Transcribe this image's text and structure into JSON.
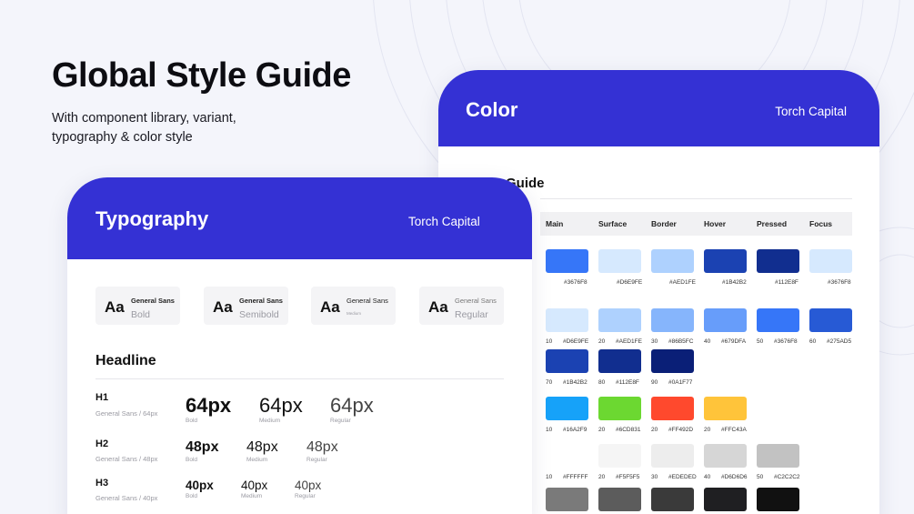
{
  "hero": {
    "title": "Global Style Guide",
    "subtitle_line1": "With component library, variant,",
    "subtitle_line2": "typography & color style"
  },
  "colors": {
    "brand_blue": "#3431D4",
    "background": "#F4F5FB"
  },
  "color_card": {
    "title": "Color",
    "brand": "Torch Capital",
    "section_title_visible": "Guide",
    "columns": [
      "Main",
      "Surface",
      "Border",
      "Hover",
      "Pressed",
      "Focus"
    ],
    "main_row": [
      {
        "hex": "#3676F8",
        "label": "#3676F8"
      },
      {
        "hex": "#D6E9FE",
        "label": "#D6E9FE"
      },
      {
        "hex": "#AED1FE",
        "label": "#AED1FE"
      },
      {
        "hex": "#1B42B2",
        "label": "#1B42B2"
      },
      {
        "hex": "#112E8F",
        "label": "#112E8F"
      },
      {
        "hex": "#D6E9FE",
        "label": "#3676F8"
      }
    ],
    "blue_scale": [
      {
        "step": "10",
        "hex": "#D6E9FE"
      },
      {
        "step": "20",
        "hex": "#AED1FE"
      },
      {
        "step": "30",
        "hex": "#86B5FC"
      },
      {
        "step": "40",
        "hex": "#679DFA"
      },
      {
        "step": "50",
        "hex": "#3676F8"
      },
      {
        "step": "60",
        "hex": "#275AD5"
      }
    ],
    "blue_dark": [
      {
        "step": "70",
        "hex": "#1B42B2"
      },
      {
        "step": "80",
        "hex": "#112E8F"
      },
      {
        "step": "90",
        "hex": "#0A1F77"
      }
    ],
    "accents": [
      {
        "step": "10",
        "hex": "#16A2F9"
      },
      {
        "step": "20",
        "hex": "#6CD831"
      },
      {
        "step": "20",
        "hex": "#FF492D"
      },
      {
        "step": "20",
        "hex": "#FFC43A"
      }
    ],
    "neutrals": [
      {
        "step": "10",
        "hex": "#FFFFFF"
      },
      {
        "step": "20",
        "hex": "#F5F5F5"
      },
      {
        "step": "30",
        "hex": "#EDEDED"
      },
      {
        "step": "40",
        "hex": "#D6D6D6"
      },
      {
        "step": "50",
        "hex": "#C2C2C2"
      }
    ],
    "darks": [
      "#7A7A7A",
      "#5C5C5C",
      "#3A3A3A",
      "#1F1F22",
      "#111111"
    ]
  },
  "typo_card": {
    "title": "Typography",
    "brand": "Torch Capital",
    "fonts": [
      {
        "aa": "Aa",
        "name": "General Sans",
        "weight": "Bold"
      },
      {
        "aa": "Aa",
        "name": "General Sans",
        "weight": "Semibold"
      },
      {
        "aa": "Aa",
        "name": "General Sans",
        "weight": "Medium"
      },
      {
        "aa": "Aa",
        "name": "General Sans",
        "weight": "Regular"
      }
    ],
    "headline_title": "Headline",
    "headings": [
      {
        "label": "H1",
        "meta": "General Sans / 64px",
        "sample": "64px",
        "caps": [
          "Bold",
          "Medium",
          "Regular"
        ]
      },
      {
        "label": "H2",
        "meta": "General Sans / 48px",
        "sample": "48px",
        "caps": [
          "Bold",
          "Medium",
          "Regular"
        ]
      },
      {
        "label": "H3",
        "meta": "General Sans / 40px",
        "sample": "40px",
        "caps": [
          "Bold",
          "Medium",
          "Regular"
        ]
      }
    ]
  }
}
